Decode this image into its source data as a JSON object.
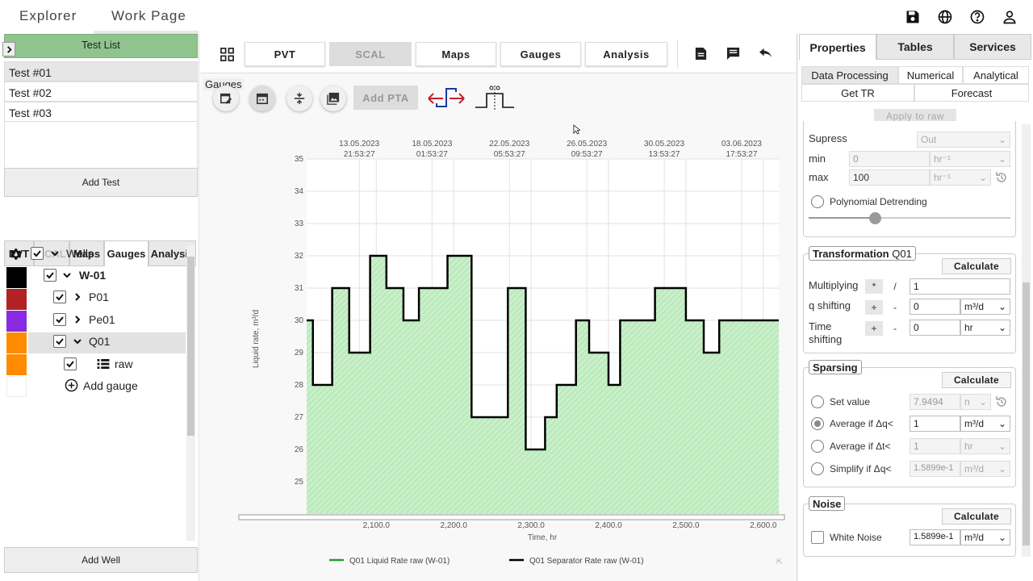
{
  "top": {
    "tabs": [
      "Explorer",
      "Work Page"
    ],
    "icons": [
      "save-icon",
      "globe-icon",
      "help-icon",
      "user-icon"
    ]
  },
  "left": {
    "test_list_title": "Test List",
    "expand_icon": "chevron-right-icon",
    "tests": [
      "Test #01",
      "Test #02",
      "Test #03"
    ],
    "add_test": "Add Test",
    "tabs": [
      "PVT",
      "SCAL",
      "Maps",
      "Gauges",
      "Analysis"
    ],
    "tree": {
      "wells": "Wells",
      "well": "W-01",
      "gauges": [
        "P01",
        "Pe01",
        "Q01"
      ],
      "raw": "raw",
      "add_gauge": "Add gauge"
    },
    "swatch_colors": [
      "#000000",
      "#b22222",
      "#8a2be2",
      "#ff8c00",
      "#ff8c00"
    ],
    "add_well": "Add Well"
  },
  "center": {
    "nav": [
      "PVT",
      "SCAL",
      "Maps",
      "Gauges",
      "Analysis"
    ],
    "tooltip": "Gauges",
    "add_pta": "Add PTA",
    "legend": [
      "Q01 Liquid Rate raw (W-01)",
      "Q01 Separator Rate raw (W-01)"
    ]
  },
  "right": {
    "tabs": [
      "Properties",
      "Tables",
      "Services"
    ],
    "subtabs": [
      "Data Processing",
      "Numerical",
      "Analytical",
      "Get TR",
      "Forecast"
    ],
    "apply_to_raw": "Apply to raw",
    "supress": {
      "label": "Supress",
      "value": "Out"
    },
    "min": {
      "label": "min",
      "value": "0",
      "unit": "hr⁻¹"
    },
    "max": {
      "label": "max",
      "value": "100",
      "unit": "hr⁻¹"
    },
    "polynomial": "Polynomial Detrending",
    "transformation": {
      "title_bold": "Transformation",
      "title_rest": " Q01",
      "calculate": "Calculate",
      "multiplying": "Multiplying",
      "mult_ops": [
        "*",
        "/"
      ],
      "mult_value": "1",
      "q_shifting": "q shifting",
      "q_ops": [
        "+",
        "-"
      ],
      "q_value": "0",
      "q_unit": "m³/d",
      "time_shifting_1": "Time",
      "time_shifting_2": "shifting",
      "t_ops": [
        "+",
        "-"
      ],
      "t_value": "0",
      "t_unit": "hr"
    },
    "sparsing": {
      "title": "Sparsing",
      "calculate": "Calculate",
      "rows": [
        {
          "label": "Set value",
          "value": "7.9494",
          "unit": "n"
        },
        {
          "label": "Average if Δq<",
          "value": "1",
          "unit": "m³/d"
        },
        {
          "label": "Average if Δt<",
          "value": "1",
          "unit": "hr"
        },
        {
          "label": "Simplify if Δq<",
          "value": "1.5899e-1",
          "unit": "m³/d"
        }
      ]
    },
    "noise": {
      "title": "Noise",
      "calculate": "Calculate",
      "label": "White Noise",
      "value": "1.5899e-1",
      "unit": "m³/d"
    }
  },
  "chart_data": {
    "type": "area",
    "step": true,
    "xlabel": "Time, hr",
    "ylabel": "Liquid rate, m³/d",
    "xlim": [
      2010,
      2620
    ],
    "ylim": [
      24,
      35
    ],
    "x_ticks": [
      2100,
      2200,
      2300,
      2400,
      2500,
      2600
    ],
    "x_tick_labels": [
      "2,100.0",
      "2,200.0",
      "2,300.0",
      "2,400.0",
      "2,500.0",
      "2,600.0"
    ],
    "y_ticks": [
      25,
      26,
      27,
      28,
      29,
      30,
      31,
      32,
      33,
      34,
      35
    ],
    "date_ticks": [
      {
        "x": 2078,
        "date": "13.05.2023",
        "time": "21:53:27"
      },
      {
        "x": 2172,
        "date": "18.05.2023",
        "time": "01:53:27"
      },
      {
        "x": 2272,
        "date": "22.05.2023",
        "time": "05:53:27"
      },
      {
        "x": 2372,
        "date": "26.05.2023",
        "time": "09:53:27"
      },
      {
        "x": 2472,
        "date": "30.05.2023",
        "time": "13:53:27"
      },
      {
        "x": 2572,
        "date": "03.06.2023",
        "time": "17:53:27"
      }
    ],
    "grid": true,
    "legend_position": "bottom",
    "series": [
      {
        "name": "Q01 Liquid Rate raw (W-01)",
        "color": "#22a022",
        "fill": "#c8f0c8",
        "x": [
          2010,
          2018,
          2043,
          2065,
          2092,
          2113,
          2135,
          2155,
          2192,
          2223,
          2270,
          2293,
          2318,
          2333,
          2358,
          2375,
          2400,
          2415,
          2440,
          2460,
          2500,
          2523,
          2543,
          2565,
          2620
        ],
        "y": [
          30,
          28,
          31,
          29,
          32,
          31,
          30,
          31,
          32,
          27,
          31,
          26,
          27,
          28,
          30,
          29,
          28,
          30,
          30,
          31,
          30,
          29,
          30,
          30,
          30
        ]
      },
      {
        "name": "Q01 Separator Rate raw (W-01)",
        "color": "#000000",
        "x": [
          2010,
          2018,
          2043,
          2065,
          2092,
          2113,
          2135,
          2155,
          2192,
          2223,
          2270,
          2293,
          2318,
          2333,
          2358,
          2375,
          2400,
          2415,
          2440,
          2460,
          2500,
          2523,
          2543,
          2565,
          2620
        ],
        "y": [
          30,
          28,
          31,
          29,
          32,
          31,
          30,
          31,
          32,
          27,
          31,
          26,
          27,
          28,
          30,
          29,
          28,
          30,
          30,
          31,
          30,
          29,
          30,
          30,
          30
        ]
      }
    ]
  }
}
